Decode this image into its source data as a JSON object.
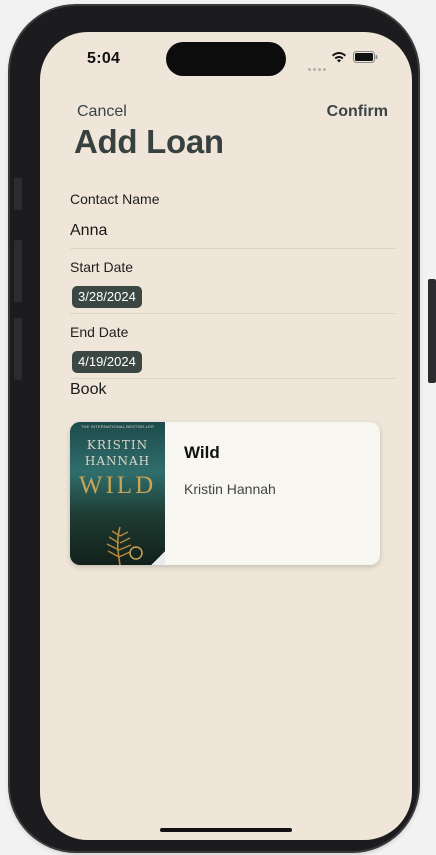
{
  "status_bar": {
    "time": "5:04",
    "icons": [
      "signal-dots-icon",
      "wifi-icon",
      "battery-icon"
    ]
  },
  "nav": {
    "cancel_label": "Cancel",
    "confirm_label": "Confirm"
  },
  "title": "Add Loan",
  "form": {
    "contact_name_label": "Contact Name",
    "contact_name_value": "Anna",
    "start_date_label": "Start Date",
    "start_date_value": "3/28/2024",
    "end_date_label": "End Date",
    "end_date_value": "4/19/2024",
    "book_label": "Book"
  },
  "book": {
    "title": "Wild",
    "author": "Kristin Hannah",
    "cover": {
      "top_line": "THE INTERNATIONAL BESTSELLER",
      "author_line1": "KRISTIN",
      "author_line2": "HANNAH",
      "title": "WILD"
    }
  },
  "colors": {
    "background": "#efe6d9",
    "accent": "#3a4743",
    "card": "#f7f6f1",
    "text_dark": "#37413f"
  }
}
